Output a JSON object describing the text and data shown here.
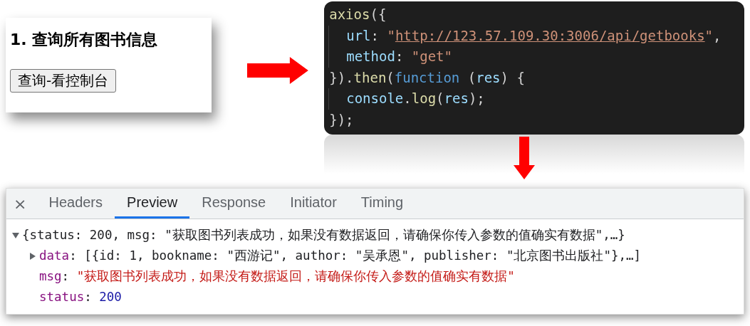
{
  "query_card": {
    "heading": "1. 查询所有图书信息",
    "button": "查询-看控制台"
  },
  "code": {
    "lines": [
      {
        "indent": false,
        "tokens": [
          {
            "kind": "fn",
            "text": "axios"
          },
          {
            "kind": "punct",
            "text": "({"
          }
        ]
      },
      {
        "indent": true,
        "tokens": [
          {
            "kind": "prop",
            "text": "url"
          },
          {
            "kind": "punct",
            "text": ": "
          },
          {
            "kind": "string",
            "text": "\""
          },
          {
            "kind": "link",
            "text": "http://123.57.109.30:3006/api/getbooks"
          },
          {
            "kind": "string",
            "text": "\""
          },
          {
            "kind": "punct",
            "text": ","
          }
        ]
      },
      {
        "indent": true,
        "tokens": [
          {
            "kind": "prop",
            "text": "method"
          },
          {
            "kind": "punct",
            "text": ": "
          },
          {
            "kind": "string",
            "text": "\"get\""
          }
        ]
      },
      {
        "indent": false,
        "tokens": [
          {
            "kind": "punct",
            "text": "})."
          },
          {
            "kind": "fn",
            "text": "then"
          },
          {
            "kind": "punct",
            "text": "("
          },
          {
            "kind": "keyword",
            "text": "function"
          },
          {
            "kind": "punct",
            "text": " ("
          },
          {
            "kind": "prop",
            "text": "res"
          },
          {
            "kind": "punct",
            "text": ") {"
          }
        ]
      },
      {
        "indent": true,
        "tokens": [
          {
            "kind": "prop",
            "text": "console"
          },
          {
            "kind": "punct",
            "text": "."
          },
          {
            "kind": "fn",
            "text": "log"
          },
          {
            "kind": "punct",
            "text": "("
          },
          {
            "kind": "prop",
            "text": "res"
          },
          {
            "kind": "punct",
            "text": ");"
          }
        ]
      },
      {
        "indent": false,
        "tokens": [
          {
            "kind": "punct",
            "text": "});"
          }
        ]
      }
    ]
  },
  "devtools": {
    "close": "×",
    "tabs": [
      {
        "label": "Headers",
        "selected": false
      },
      {
        "label": "Preview",
        "selected": true
      },
      {
        "label": "Response",
        "selected": false
      },
      {
        "label": "Initiator",
        "selected": false
      },
      {
        "label": "Timing",
        "selected": false
      }
    ],
    "rows": [
      {
        "expanded": true,
        "nested": false,
        "tokens": [
          {
            "kind": "plain",
            "text": "{status: 200, msg: \"获取图书列表成功，如果没有数据返回，请确保你传入参数的值确实有数据\",…}"
          }
        ]
      },
      {
        "expanded": false,
        "nested": true,
        "tokens": [
          {
            "kind": "key",
            "text": "data"
          },
          {
            "kind": "plain",
            "text": ": [{id: 1, bookname: \"西游记\", author: \"吴承恩\", publisher: \"北京图书出版社\"},…]"
          }
        ]
      },
      {
        "nested": true,
        "tokens": [
          {
            "kind": "key",
            "text": "msg"
          },
          {
            "kind": "plain",
            "text": ": "
          },
          {
            "kind": "string",
            "text": "\"获取图书列表成功，如果没有数据返回，请确保你传入参数的值确实有数据\""
          }
        ]
      },
      {
        "nested": true,
        "tokens": [
          {
            "kind": "key",
            "text": "status"
          },
          {
            "kind": "plain",
            "text": ": "
          },
          {
            "kind": "number",
            "text": "200"
          }
        ]
      }
    ]
  }
}
